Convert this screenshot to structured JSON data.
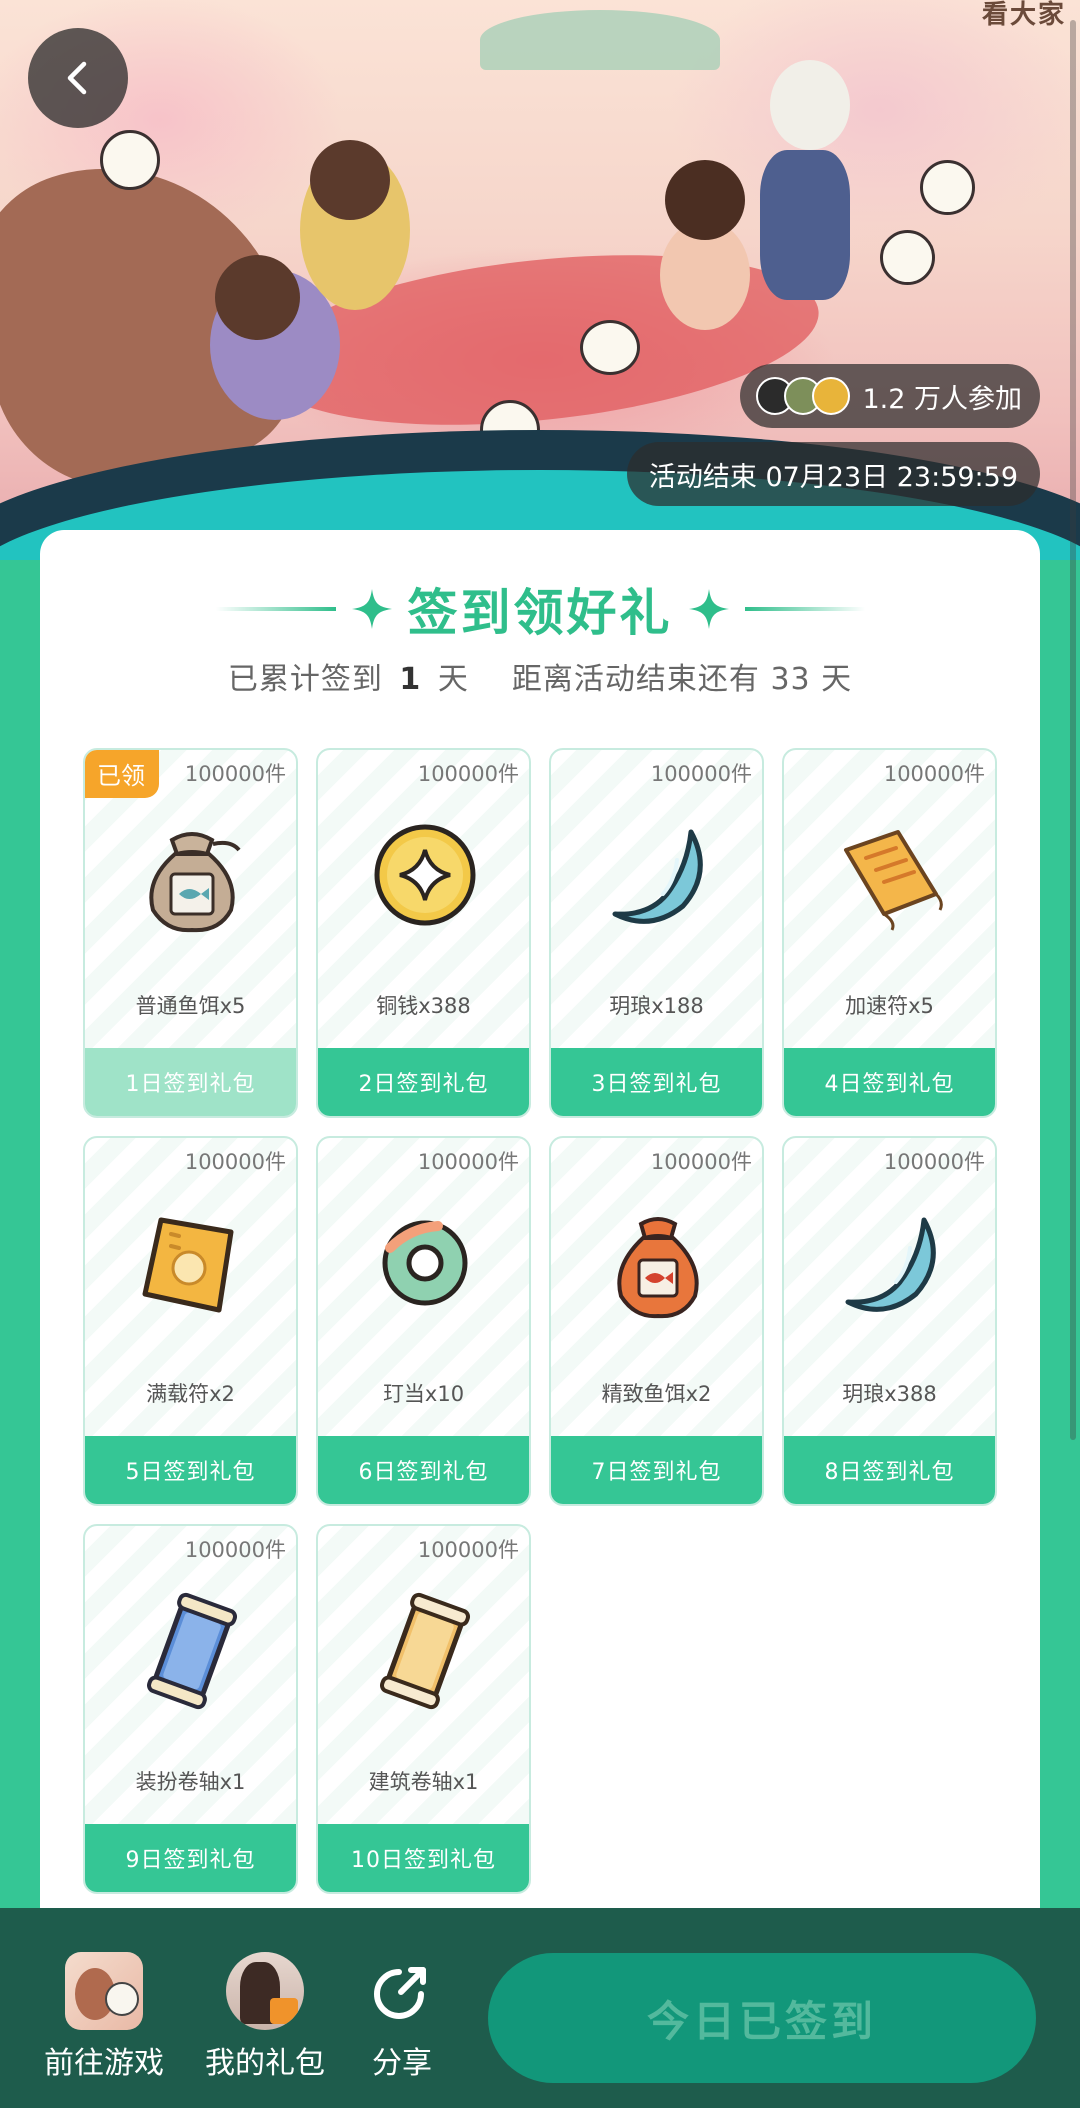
{
  "header": {
    "brand_text": "看大家",
    "participants": "1.2 万人参加",
    "end_time": "活动结束 07月23日 23:59:59"
  },
  "card": {
    "title": "签到领好礼",
    "subtitle_prefix": "已累计签到",
    "checked_days": "1",
    "subtitle_day_unit": "天",
    "subtitle_suffix": "距离活动结束还有 33 天"
  },
  "claimed_label": "已领",
  "rewards": [
    {
      "qty": "100000件",
      "name": "普通鱼饵x5",
      "button": "1日签到礼包",
      "icon": "fish-bait-bag-icon",
      "claimed": true
    },
    {
      "qty": "100000件",
      "name": "铜钱x388",
      "button": "2日签到礼包",
      "icon": "coin-icon",
      "claimed": false
    },
    {
      "qty": "100000件",
      "name": "玥琅x188",
      "button": "3日签到礼包",
      "icon": "crescent-moon-icon",
      "claimed": false
    },
    {
      "qty": "100000件",
      "name": "加速符x5",
      "button": "4日签到礼包",
      "icon": "speed-talisman-icon",
      "claimed": false
    },
    {
      "qty": "100000件",
      "name": "满载符x2",
      "button": "5日签到礼包",
      "icon": "full-load-talisman-icon",
      "claimed": false
    },
    {
      "qty": "100000件",
      "name": "玎当x10",
      "button": "6日签到礼包",
      "icon": "ring-icon",
      "claimed": false
    },
    {
      "qty": "100000件",
      "name": "精致鱼饵x2",
      "button": "7日签到礼包",
      "icon": "fine-bait-bag-icon",
      "claimed": false
    },
    {
      "qty": "100000件",
      "name": "玥琅x388",
      "button": "8日签到礼包",
      "icon": "crescent-moon-icon",
      "claimed": false
    },
    {
      "qty": "100000件",
      "name": "装扮卷轴x1",
      "button": "9日签到礼包",
      "icon": "outfit-scroll-icon",
      "claimed": false
    },
    {
      "qty": "100000件",
      "name": "建筑卷轴x1",
      "button": "10日签到礼包",
      "icon": "building-scroll-icon",
      "claimed": false
    }
  ],
  "bottom_bar": {
    "goto_game": "前往游戏",
    "my_gifts": "我的礼包",
    "share": "分享",
    "checkin_button": "今日已签到"
  },
  "colors": {
    "accent": "#35c695",
    "claimed_badge": "#f6a52a",
    "bottom_bar": "#1e5c4c",
    "checkin_button": "#12977a"
  }
}
